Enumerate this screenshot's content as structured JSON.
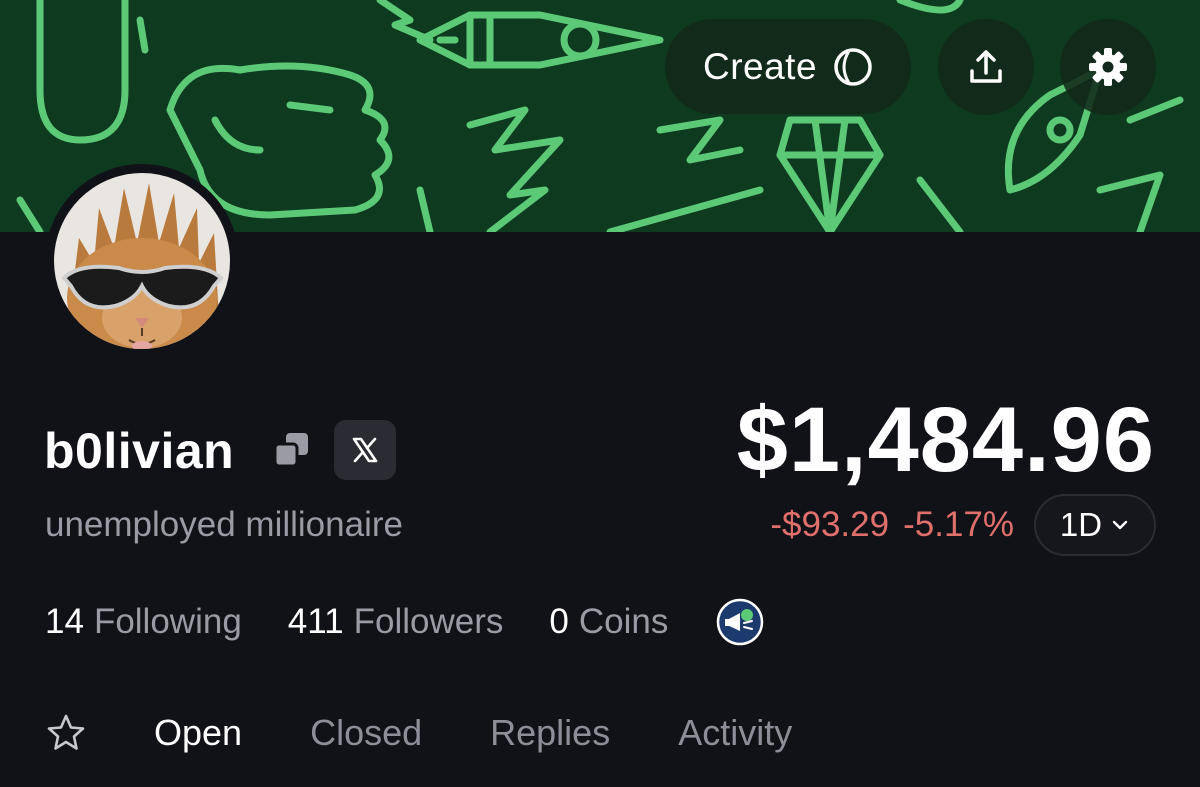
{
  "header": {
    "create_label": "Create",
    "icons": [
      "create-circle-icon",
      "share-upload-icon",
      "gear-icon"
    ]
  },
  "profile": {
    "username": "b0livian",
    "bio": "unemployed millionaire",
    "x_badge": "𝕏",
    "avatar": "cat-with-sunglasses-avatar"
  },
  "portfolio": {
    "balance": "$1,484.96",
    "change_amount": "-$93.29",
    "change_percent": "-5.17%",
    "period": "1D",
    "change_color": "#e0706c"
  },
  "stats": [
    {
      "count": "14",
      "label": "Following"
    },
    {
      "count": "411",
      "label": "Followers"
    },
    {
      "count": "0",
      "label": "Coins"
    }
  ],
  "tabs": [
    "Open",
    "Closed",
    "Replies",
    "Activity"
  ],
  "colors": {
    "banner": "#0e3a1f",
    "doodle": "#5cc977",
    "background": "#111118"
  }
}
